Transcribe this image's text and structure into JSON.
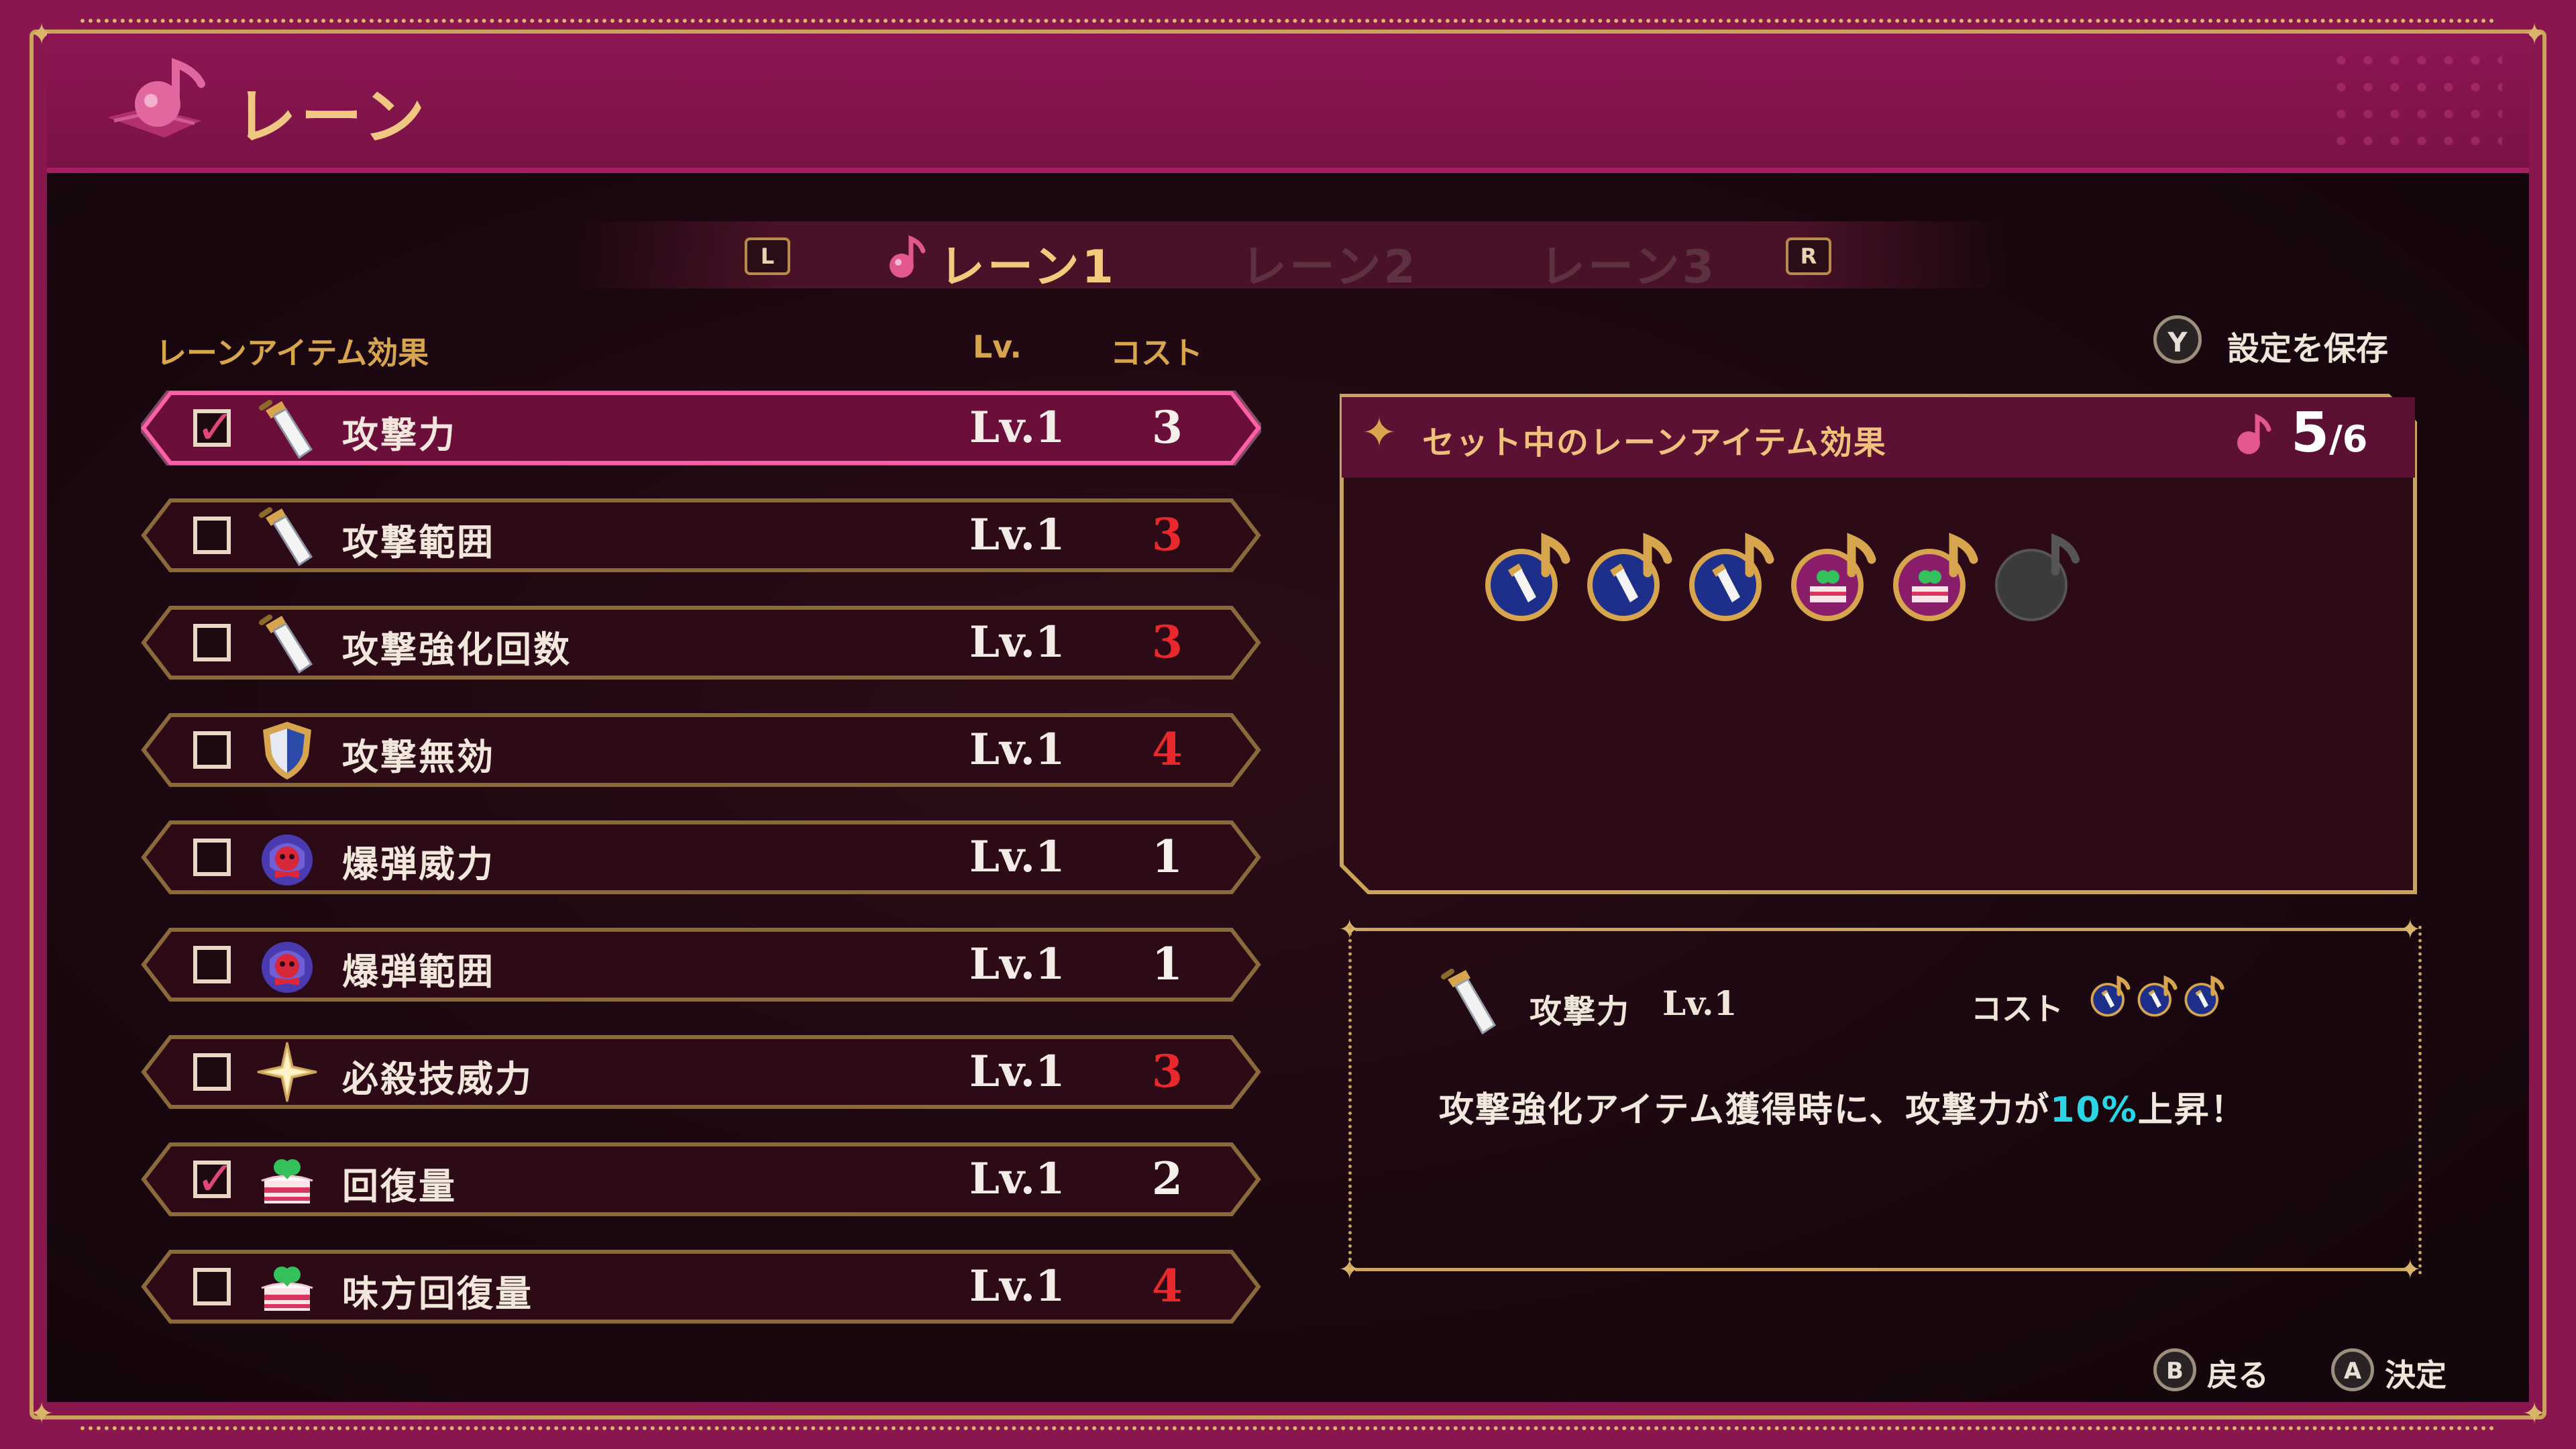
{
  "header": {
    "title": "レーン"
  },
  "tabs": {
    "left_key": "L",
    "right_key": "R",
    "items": [
      {
        "label": "レーン1",
        "active": true
      },
      {
        "label": "レーン2",
        "active": false
      },
      {
        "label": "レーン3",
        "active": false
      }
    ]
  },
  "list": {
    "col_effect": "レーンアイテム効果",
    "col_lv": "Lv.",
    "col_cost": "コスト",
    "rows": [
      {
        "label": "攻撃力",
        "lv": "Lv.1",
        "cost": "3",
        "checked": true,
        "icon": "sword-icon",
        "cost_color": "white",
        "selected": true
      },
      {
        "label": "攻撃範囲",
        "lv": "Lv.1",
        "cost": "3",
        "checked": false,
        "icon": "sword-icon",
        "cost_color": "red"
      },
      {
        "label": "攻撃強化回数",
        "lv": "Lv.1",
        "cost": "3",
        "checked": false,
        "icon": "sword-icon",
        "cost_color": "red"
      },
      {
        "label": "攻撃無効",
        "lv": "Lv.1",
        "cost": "4",
        "checked": false,
        "icon": "shield-icon",
        "cost_color": "red"
      },
      {
        "label": "爆弾威力",
        "lv": "Lv.1",
        "cost": "1",
        "checked": false,
        "icon": "bomb-skull-icon",
        "cost_color": "white"
      },
      {
        "label": "爆弾範囲",
        "lv": "Lv.1",
        "cost": "1",
        "checked": false,
        "icon": "bomb-skull-icon",
        "cost_color": "white"
      },
      {
        "label": "必殺技威力",
        "lv": "Lv.1",
        "cost": "3",
        "checked": false,
        "icon": "star-icon",
        "cost_color": "red"
      },
      {
        "label": "回復量",
        "lv": "Lv.1",
        "cost": "2",
        "checked": true,
        "icon": "cake-icon",
        "cost_color": "white"
      },
      {
        "label": "味方回復量",
        "lv": "Lv.1",
        "cost": "4",
        "checked": false,
        "icon": "cake-icon",
        "cost_color": "red"
      }
    ]
  },
  "save": {
    "key": "Y",
    "label": "設定を保存"
  },
  "set_panel": {
    "title": "セット中のレーンアイテム効果",
    "count_used": "5",
    "count_total": "/6",
    "slots": [
      "sword",
      "sword",
      "sword",
      "cake",
      "cake",
      "empty"
    ]
  },
  "description": {
    "name": "攻撃力",
    "lv": "Lv.1",
    "cost_label": "コスト",
    "cost_icons": 3,
    "text_before": "攻撃強化アイテム獲得時に、攻撃力が",
    "text_highlight": "10%",
    "text_after": "上昇！"
  },
  "bottom": {
    "back_key": "B",
    "back_label": "戻る",
    "ok_key": "A",
    "ok_label": "決定"
  },
  "colors": {
    "frame": "#8a1650",
    "gold": "#c9a55b",
    "cost_red": "#e8282b",
    "highlight_cyan": "#2ad6e6",
    "selected_glow": "#ff5fa8"
  }
}
